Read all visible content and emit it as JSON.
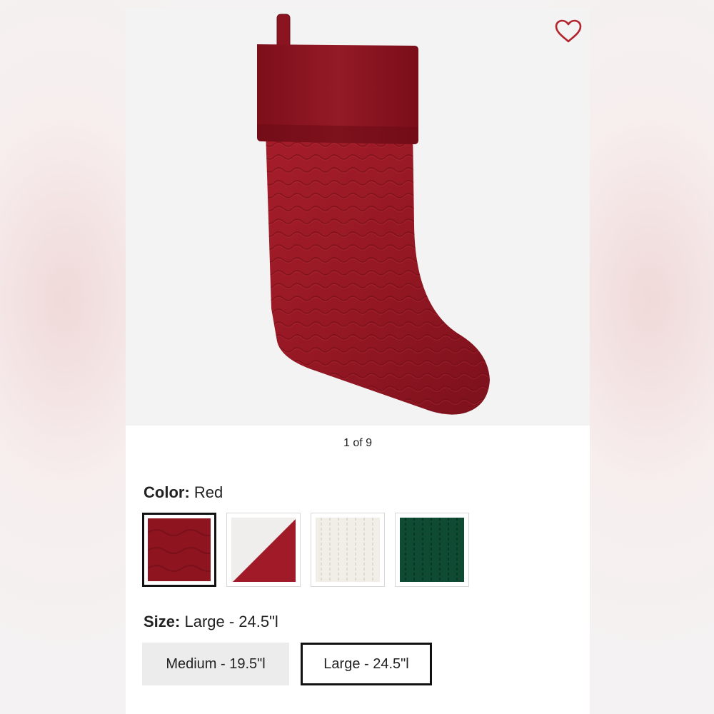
{
  "product": {
    "image_alt": "Red velvet quilted stocking",
    "image_counter": "1 of 9"
  },
  "icons": {
    "favorite": "heart-outline-icon"
  },
  "color": {
    "label": "Color:",
    "selected": "Red",
    "swatches": [
      {
        "name": "Red",
        "primary": "#8e1520"
      },
      {
        "name": "Red/White",
        "primary": "#a01a28",
        "secondary": "#efeeec"
      },
      {
        "name": "White",
        "primary": "#f1eee8"
      },
      {
        "name": "Green",
        "primary": "#0f4a32"
      }
    ]
  },
  "size": {
    "label": "Size:",
    "selected": "Large - 24.5\"l",
    "options": [
      "Medium - 19.5\"l",
      "Large - 24.5\"l"
    ]
  },
  "colors": {
    "accent": "#b3242d",
    "selected_border": "#111111",
    "muted_button": "#ececec"
  }
}
